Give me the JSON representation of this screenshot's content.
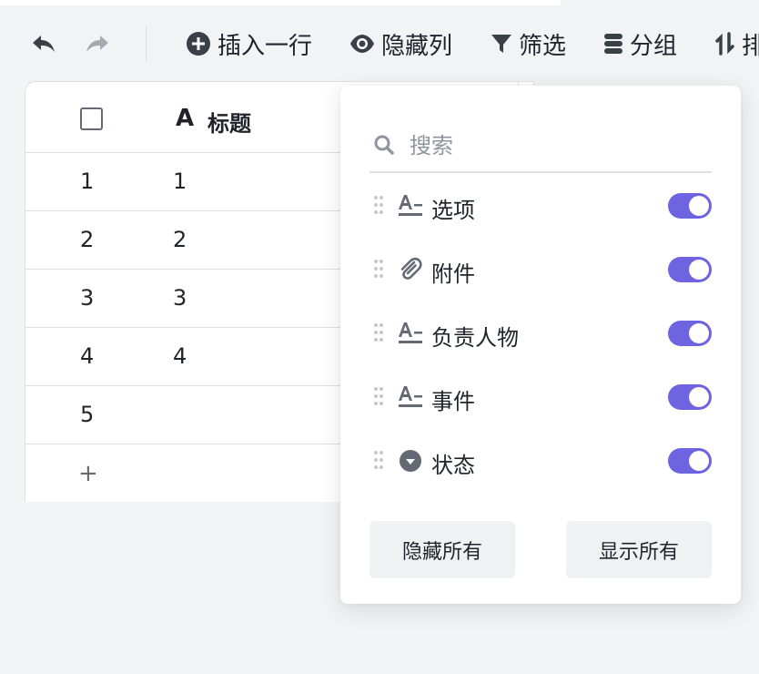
{
  "toolbar": {
    "insert_row": "插入一行",
    "hide_columns": "隐藏列",
    "filter": "筛选",
    "group": "分组",
    "sort": "排"
  },
  "table": {
    "header_title": "标题",
    "header_glyph": "A",
    "rows": [
      {
        "num": "1",
        "title": "1"
      },
      {
        "num": "2",
        "title": "2"
      },
      {
        "num": "3",
        "title": "3"
      },
      {
        "num": "4",
        "title": "4"
      },
      {
        "num": "5",
        "title": ""
      }
    ],
    "add_row_symbol": "+"
  },
  "popover": {
    "search_placeholder": "搜索",
    "fields": [
      {
        "label": "选项",
        "icon": "text-field-icon",
        "visible": true
      },
      {
        "label": "附件",
        "icon": "paperclip-icon",
        "visible": true
      },
      {
        "label": "负责人物",
        "icon": "text-field-icon",
        "visible": true
      },
      {
        "label": "事件",
        "icon": "text-field-icon",
        "visible": true
      },
      {
        "label": "状态",
        "icon": "status-select-icon",
        "visible": true
      }
    ],
    "hide_all": "隐藏所有",
    "show_all": "显示所有"
  },
  "colors": {
    "toggle_on": "#6e63e0",
    "background": "#f2f3f5",
    "border": "#dee0e3",
    "text": "#1f2329",
    "icon": "#646a73"
  }
}
